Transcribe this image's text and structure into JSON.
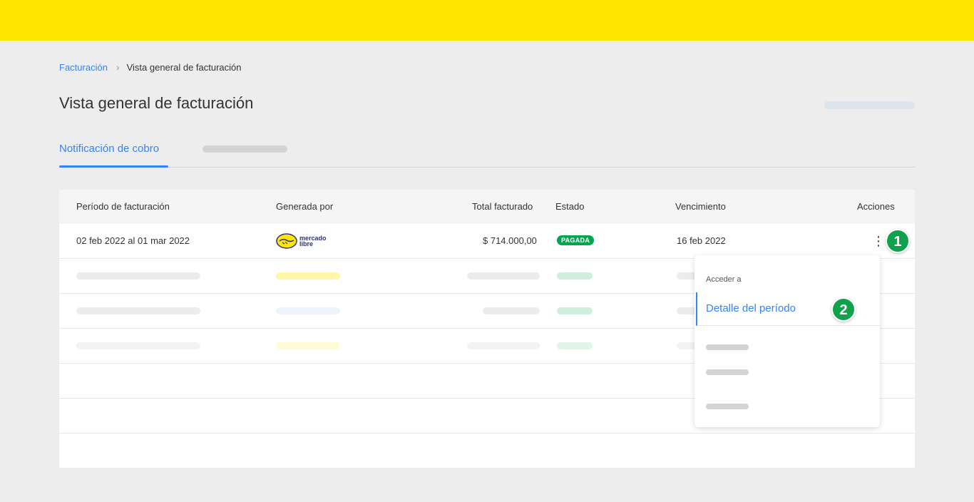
{
  "breadcrumb": {
    "link": "Facturación",
    "separator": "›",
    "current": "Vista general de facturación"
  },
  "page": {
    "title": "Vista general de facturación"
  },
  "tabs": {
    "active": "Notificación de cobro"
  },
  "table": {
    "headers": [
      "Período de facturación",
      "Generada por",
      "Total facturado",
      "Estado",
      "Vencimiento",
      "Acciones"
    ],
    "row": {
      "period": "02 feb 2022 al 01 mar 2022",
      "generator_line1": "mercado",
      "generator_line2": "libre",
      "total": "$ 714.000,00",
      "status": "PAGADA",
      "due": "16 feb 2022",
      "actions_icon": "⋮"
    }
  },
  "menu": {
    "heading": "Acceder a",
    "item": "Detalle del período"
  },
  "steps": {
    "one": "1",
    "two": "2"
  },
  "colors": {
    "brand_yellow": "#ffe600",
    "accent_blue": "#3483fa",
    "status_green": "#00a650",
    "step_green": "#10a14d"
  },
  "icons": {
    "breadcrumb_separator": "chevron-right-icon",
    "actions": "more-vertical-icon",
    "logo": "mercado-libre-logo"
  }
}
